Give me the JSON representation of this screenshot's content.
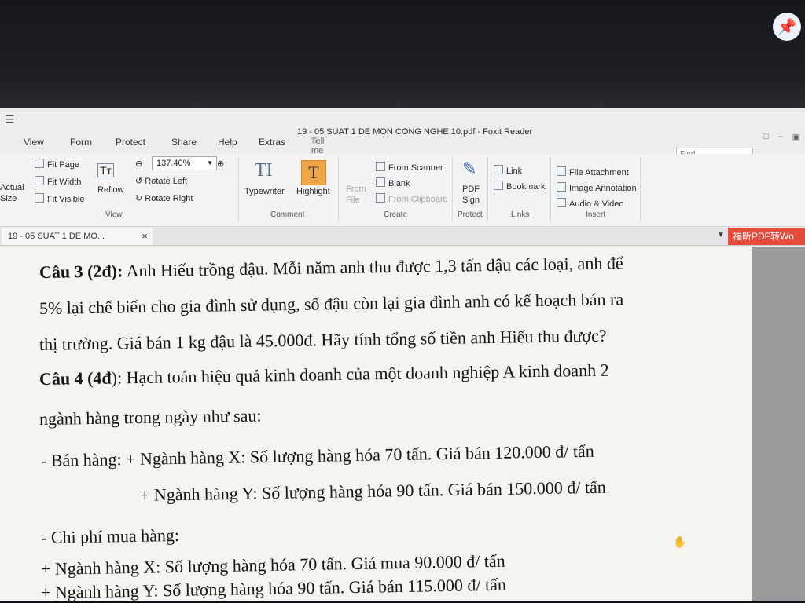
{
  "window": {
    "title": "19 - 05 SUAT 1 DE MON CONG NGHE 10.pdf - Foxit Reader"
  },
  "menu": {
    "items": [
      "View",
      "Form",
      "Protect",
      "Share",
      "Help",
      "Extras"
    ],
    "tell_me": "Tell me what you want to do...",
    "find_placeholder": "Find"
  },
  "ribbon": {
    "view": {
      "actual_size": "Actual Size",
      "fit_page": "Fit Page",
      "fit_width": "Fit Width",
      "fit_visible": "Fit Visible",
      "reflow": "Reflow",
      "zoom": "137.40%",
      "rotate_left": "Rotate Left",
      "rotate_right": "Rotate Right",
      "group": "View"
    },
    "comment": {
      "typewriter": "Typewriter",
      "highlight": "Highlight",
      "group": "Comment"
    },
    "create": {
      "from_file": "From File",
      "from_scanner": "From Scanner",
      "blank": "Blank",
      "from_clipboard": "From Clipboard",
      "group": "Create"
    },
    "protect": {
      "pdf_sign": "PDF Sign",
      "group": "Protect"
    },
    "links": {
      "link": "Link",
      "bookmark": "Bookmark",
      "group": "Links"
    },
    "insert": {
      "file_attachment": "File Attachment",
      "image_annotation": "Image Annotation",
      "audio_video": "Audio & Video",
      "group": "Insert"
    }
  },
  "tabs": {
    "document_tab": "19 - 05 SUAT 1 DE MO...",
    "close": "×",
    "promo": "福昕PDF转Wo"
  },
  "document": {
    "q3_label": "Câu 3 (2đ):",
    "q3_line1": " Anh Hiếu trồng đậu. Mỗi năm anh thu được 1,3 tấn đậu các loại, anh để",
    "q3_line2": "5% lại chế biến cho gia đình sử dụng, số đậu còn lại gia đình anh có kế hoạch bán ra",
    "q3_line3": "thị trường. Giá bán 1 kg đậu là 45.000đ. Hãy tính tổng số tiền anh Hiếu thu được?",
    "q4_label": "Câu 4 (4đ",
    "q4_line1": "): Hạch toán hiệu quả kinh doanh của một doanh nghiệp A kinh doanh 2",
    "q4_line2": "ngành hàng trong ngày như sau:",
    "sales_x": "- Bán hàng: + Ngành hàng X: Số lượng hàng hóa 70 tấn. Giá bán 120.000 đ/ tấn",
    "sales_y": "+ Ngành hàng Y: Số lượng hàng hóa 90 tấn. Giá bán 150.000 đ/ tấn",
    "cost_heading": "- Chi phí mua hàng:",
    "cost_x": "+ Ngành hàng X: Số lượng hàng hóa 70 tấn. Giá mua 90.000 đ/ tấn",
    "cost_y": "+ Ngành hàng Y: Số lượng hàng hóa 90 tấn. Giá bán 115.000 đ/ tấn"
  }
}
